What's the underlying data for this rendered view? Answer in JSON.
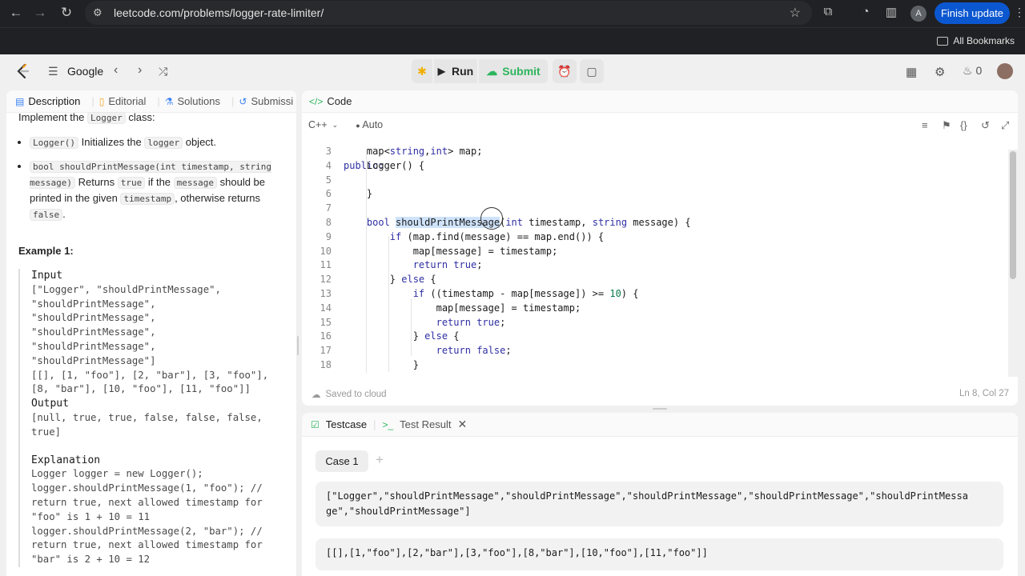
{
  "browser": {
    "url": "leetcode.com/problems/logger-rate-limiter/",
    "profile_initial": "A",
    "finish_update_label": "Finish update",
    "bookmarks_label": "All Bookmarks"
  },
  "nav": {
    "problem_list": "Google",
    "run_label": "Run",
    "submit_label": "Submit",
    "streak_count": "0"
  },
  "left_tabs": [
    "Description",
    "Editorial",
    "Solutions",
    "Submissi"
  ],
  "description": {
    "intro_pre": "Implement the ",
    "intro_code": "Logger",
    "intro_post": " class:",
    "b1_code": "Logger()",
    "b1_mid": " Initializes the ",
    "b1_code2": "logger",
    "b1_post": " object.",
    "b2_code": "bool shouldPrintMessage(int timestamp, string message)",
    "b2_mid": " Returns ",
    "b2_code2": "true",
    "b2_mid2": " if the ",
    "b2_code3": "message",
    "b2_mid3": " should be printed in the given ",
    "b2_code4": "timestamp",
    "b2_mid4": ", otherwise returns ",
    "b2_code5": "false",
    "b2_post": "."
  },
  "example": {
    "title": "Example 1:",
    "input_label": "Input",
    "input_lines": [
      "[\"Logger\", \"shouldPrintMessage\",",
      "\"shouldPrintMessage\",",
      "\"shouldPrintMessage\",",
      "\"shouldPrintMessage\",",
      "\"shouldPrintMessage\",",
      "\"shouldPrintMessage\"]",
      "[[], [1, \"foo\"], [2, \"bar\"], [3, \"foo\"],",
      "[8, \"bar\"], [10, \"foo\"], [11, \"foo\"]]"
    ],
    "output_label": "Output",
    "output_lines": [
      "[null, true, true, false, false, false,",
      "true]"
    ],
    "explanation_label": "Explanation",
    "explanation_lines": [
      "Logger logger = new Logger();",
      "logger.shouldPrintMessage(1, \"foo\");  //",
      "return true, next allowed timestamp for",
      "\"foo\" is 1 + 10 = 11",
      "logger.shouldPrintMessage(2, \"bar\");  //",
      "return true, next allowed timestamp for",
      "\"bar\" is 2 + 10 = 12"
    ]
  },
  "code_panel": {
    "title": "Code",
    "language": "C++",
    "mode": "Auto",
    "saved": "Saved to cloud",
    "cursor": "Ln 8, Col 27"
  },
  "code_lines": [
    {
      "n": "3",
      "t": "    map<string,int> map;"
    },
    {
      "n": "4",
      "t": "    Logger() {"
    },
    {
      "n": "5",
      "t": ""
    },
    {
      "n": "6",
      "t": "    }"
    },
    {
      "n": "7",
      "t": ""
    },
    {
      "n": "8",
      "t": "    bool shouldPrintMessage(int timestamp, string message) {"
    },
    {
      "n": "9",
      "t": "        if (map.find(message) == map.end()) {"
    },
    {
      "n": "10",
      "t": "            map[message] = timestamp;"
    },
    {
      "n": "11",
      "t": "            return true;"
    },
    {
      "n": "12",
      "t": "        } else {"
    },
    {
      "n": "13",
      "t": "            if ((timestamp - map[message]) >= 10) {"
    },
    {
      "n": "14",
      "t": "                map[message] = timestamp;"
    },
    {
      "n": "15",
      "t": "                return true;"
    },
    {
      "n": "16",
      "t": "            } else {"
    },
    {
      "n": "17",
      "t": "                return false;"
    },
    {
      "n": "18",
      "t": "            }"
    }
  ],
  "test_panel": {
    "testcase_tab": "Testcase",
    "result_tab": "Test Result",
    "case_label": "Case 1",
    "input1_line1": "[\"Logger\",\"shouldPrintMessage\",\"shouldPrintMessage\",\"shouldPrintMessage\",\"shouldPrintMessage\",\"shouldPrintMessa",
    "input1_line2": "ge\",\"shouldPrintMessage\"]",
    "input2": "[[],[1,\"foo\"],[2,\"bar\"],[3,\"foo\"],[8,\"bar\"],[10,\"foo\"],[11,\"foo\"]]"
  }
}
